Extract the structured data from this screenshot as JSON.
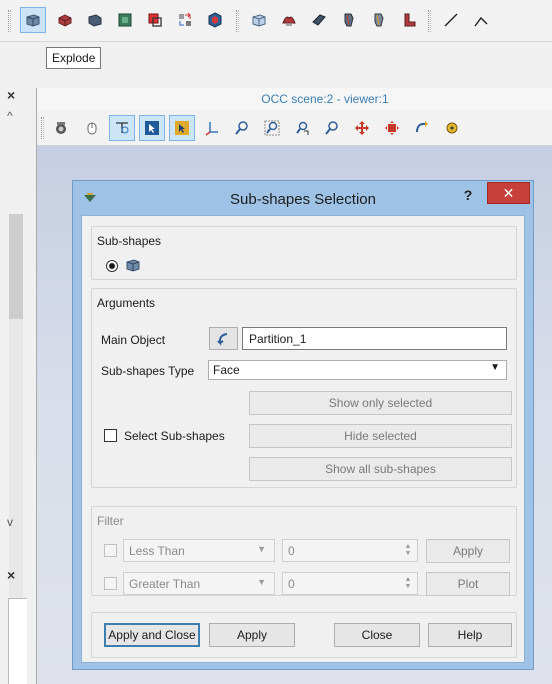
{
  "toolbar": {
    "tooltip": "Explode",
    "icons": [
      {
        "name": "explode-icon",
        "active": true
      },
      {
        "name": "box-icon"
      },
      {
        "name": "solid-icon"
      },
      {
        "name": "shell-icon"
      },
      {
        "name": "boolean-icon"
      },
      {
        "name": "transform-icon"
      },
      {
        "name": "sphere-icon"
      },
      {
        "name": "partition-icon"
      },
      {
        "name": "archimede-icon"
      },
      {
        "name": "fillet-icon"
      },
      {
        "name": "chamfer-icon"
      },
      {
        "name": "extrusion-icon"
      },
      {
        "name": "revolution-icon"
      },
      {
        "name": "line-icon"
      }
    ]
  },
  "viewer": {
    "title": "OCC scene:2 - viewer:1",
    "icons": [
      "dump-view-icon",
      "interaction-style-icon",
      "zooming-style-icon",
      "show-selection-icon",
      "selection-preview-icon",
      "trihedron-icon",
      "fit-all-icon",
      "fit-area-icon",
      "fit-selection-icon",
      "zoom-icon",
      "pan-icon",
      "global-pan-icon",
      "rotate-icon",
      "rotation-point-icon"
    ]
  },
  "dialog": {
    "title": "Sub-shapes Selection",
    "help": "?",
    "close": "✕",
    "subshapes_group": "Sub-shapes",
    "arguments_group": "Arguments",
    "main_object_label": "Main Object",
    "main_object_value": "Partition_1",
    "type_label": "Sub-shapes Type",
    "type_value": "Face",
    "show_only_selected": "Show only selected",
    "select_subshapes": "Select Sub-shapes",
    "hide_selected": "Hide selected",
    "show_all": "Show all sub-shapes",
    "filter_group": "Filter",
    "less_than": "Less Than",
    "less_value": "0",
    "apply_filter": "Apply",
    "greater_than": "Greater Than",
    "greater_value": "0",
    "plot": "Plot",
    "apply_and_close": "Apply and Close",
    "apply": "Apply",
    "close_btn": "Close",
    "help_btn": "Help"
  },
  "colors": {
    "accent": "#3c7fb1",
    "dialog_frame": "#9fc3e6",
    "close_red": "#c7403a"
  }
}
